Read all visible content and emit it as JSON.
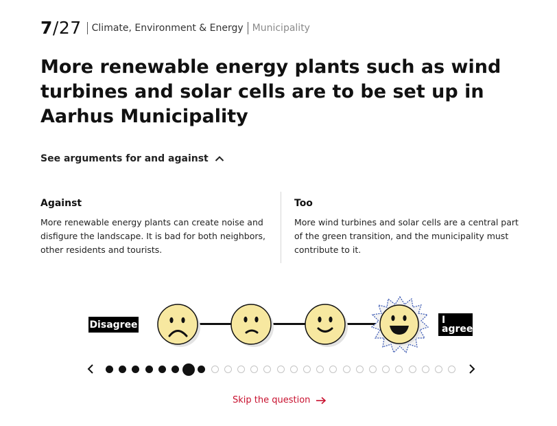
{
  "header": {
    "counter_current": "7",
    "counter_total": "/27",
    "category": "Climate, Environment & Energy",
    "subcategory": "Municipality"
  },
  "question": {
    "title": "More renewable energy plants such as wind turbines and solar cells are to be set up in Aarhus Municipality"
  },
  "arguments": {
    "toggle_label": "See arguments for and against",
    "toggle_icon": "chevron-up-icon",
    "against": {
      "heading": "Against",
      "text": "More renewable energy plants can create noise and disfigure the landscape. It is bad for both neighbors, other residents and tourists."
    },
    "for": {
      "heading": "Too",
      "text": "More wind turbines and solar cells are a central part of the green transition, and the municipality must contribute to it."
    }
  },
  "scale": {
    "left_label": "Disagree",
    "right_label_line1": "I",
    "right_label_line2": "agree",
    "options": [
      "sad-face-icon",
      "slightly-sad-face-icon",
      "slight-smile-face-icon",
      "big-smile-face-icon"
    ],
    "selected_index": 3
  },
  "pager": {
    "total": 27,
    "current": 7,
    "prev_icon": "chevron-left-icon",
    "next_icon": "chevron-right-icon"
  },
  "skip": {
    "label": "Skip the question",
    "icon": "arrow-right-icon"
  },
  "colors": {
    "accent_red": "#c8102e",
    "face_yellow": "#f7e8a0",
    "ink": "#111111",
    "dot_empty": "#c4c4c4",
    "selected_burst": "#2f4fb0"
  }
}
